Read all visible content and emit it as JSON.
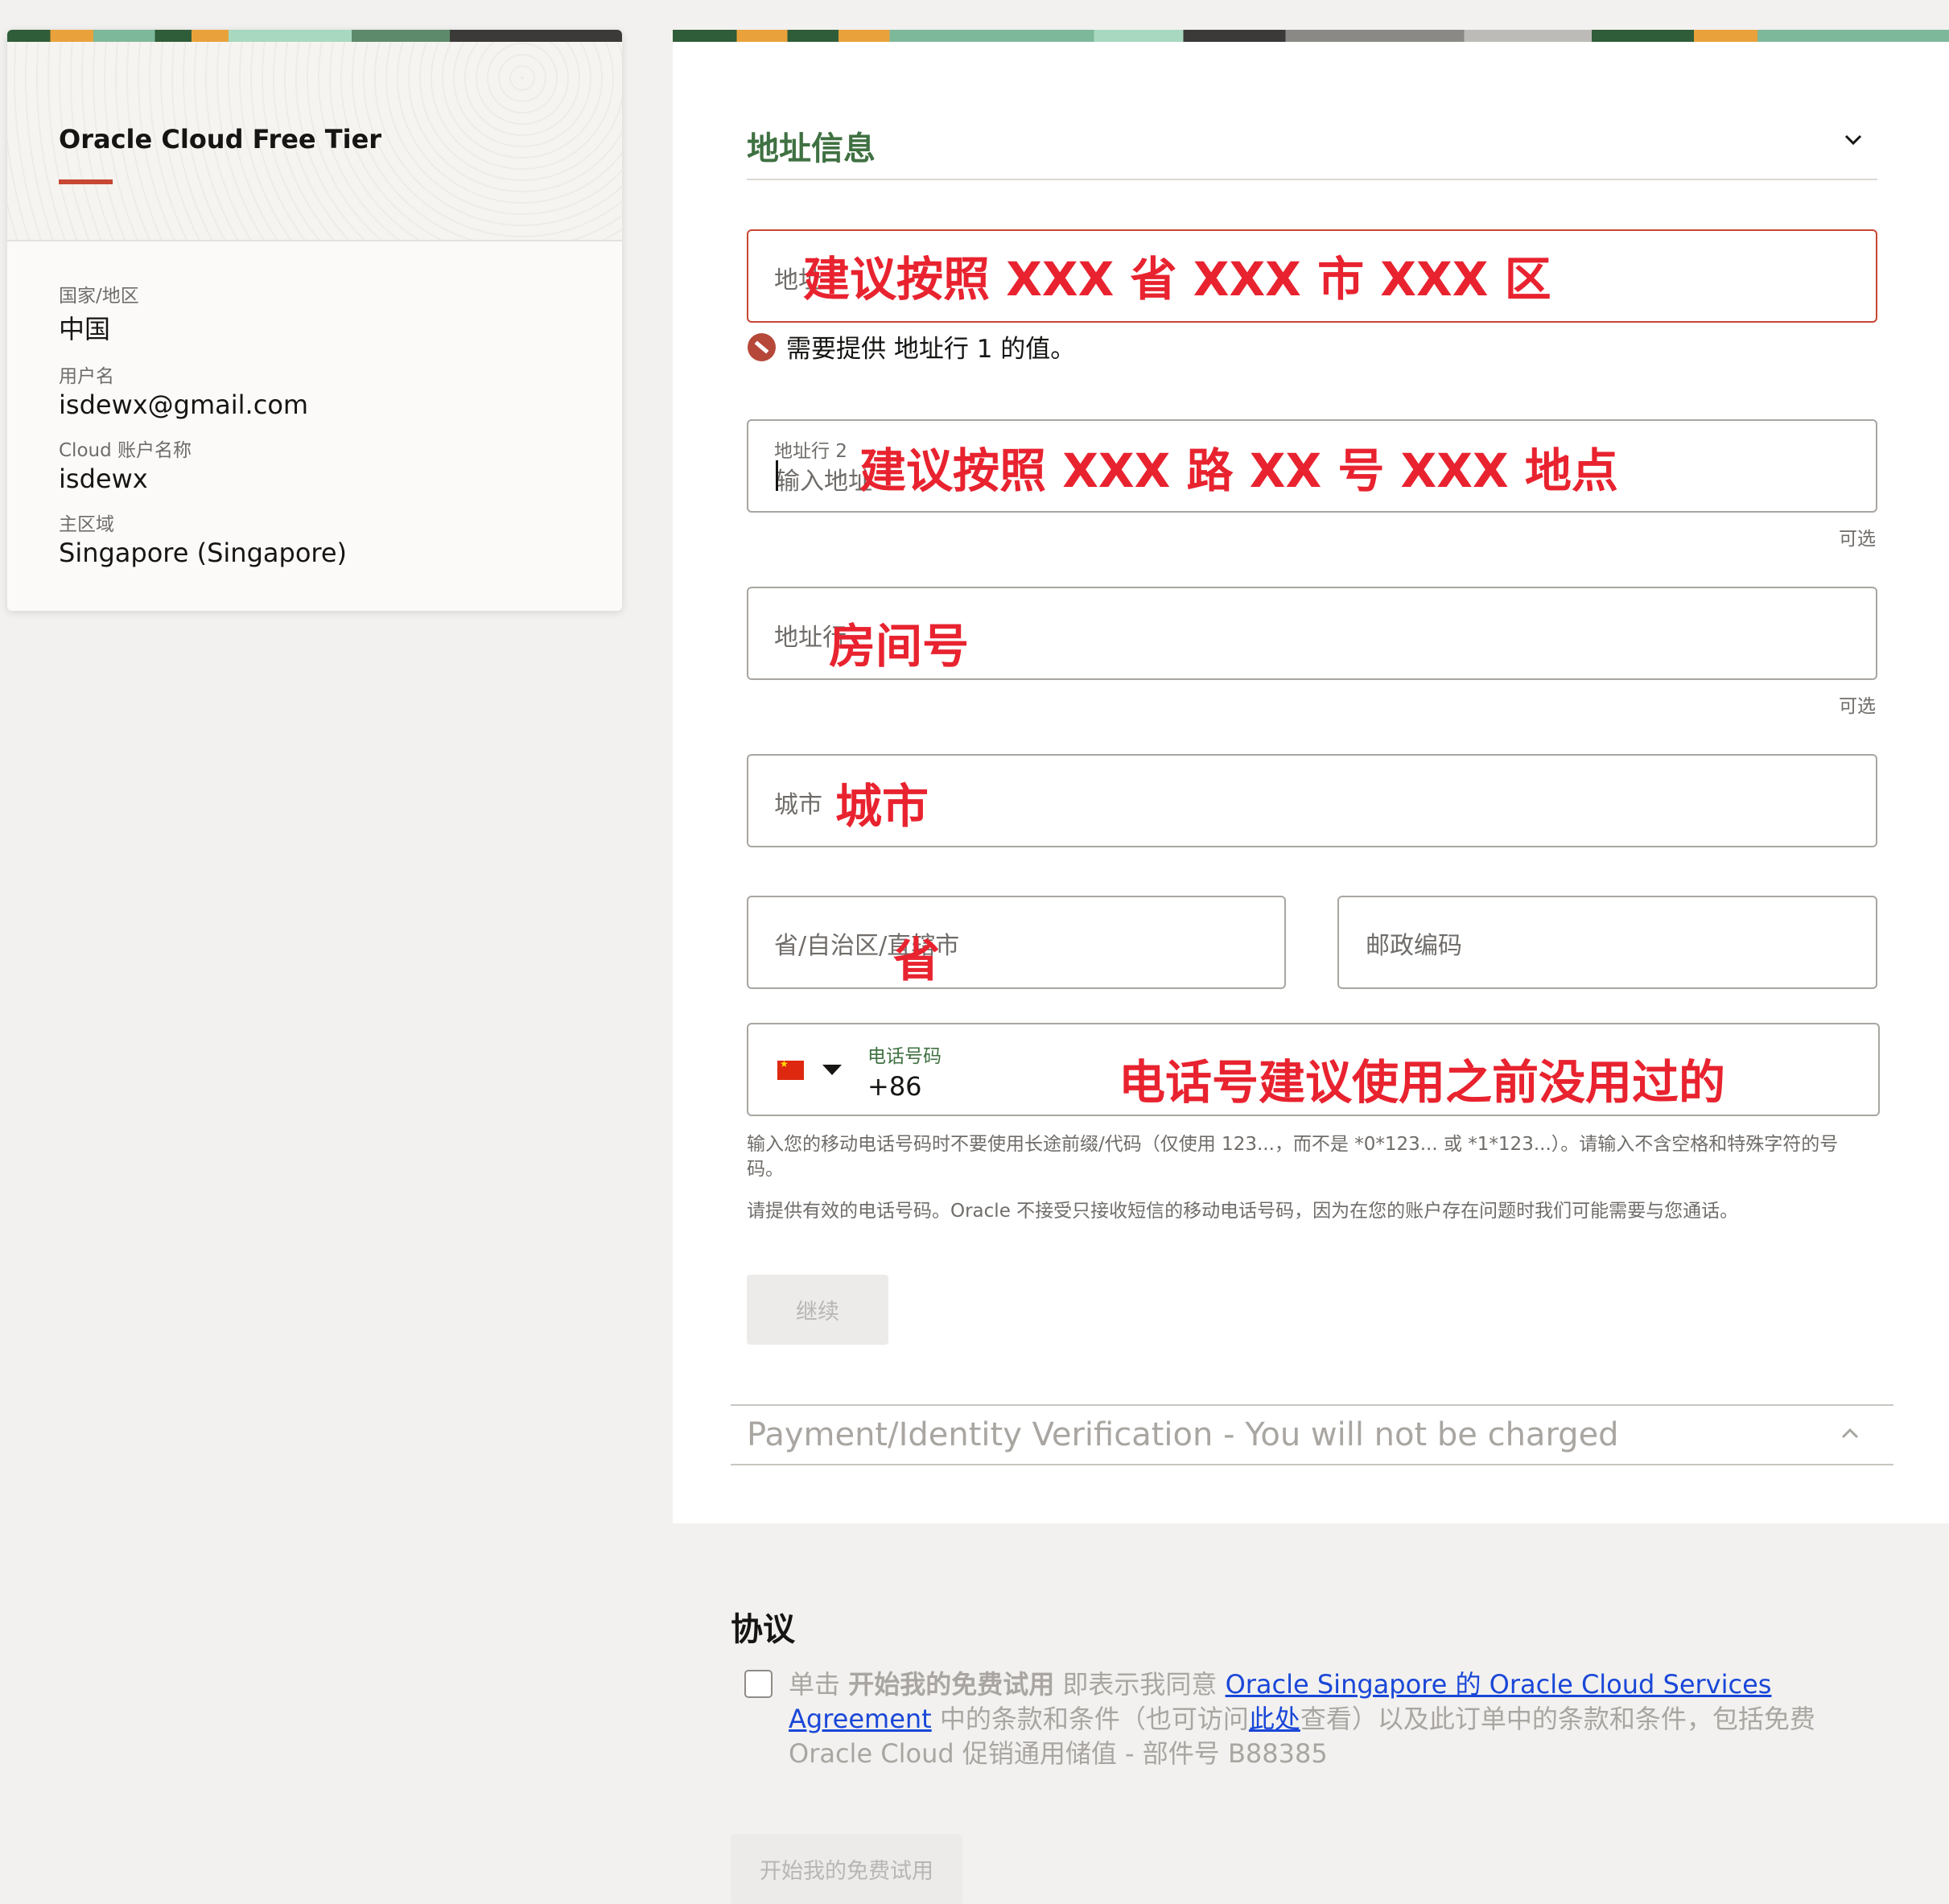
{
  "left_panel": {
    "title": "Oracle Cloud Free Tier",
    "fields": [
      {
        "label": "国家/地区",
        "value": "中国"
      },
      {
        "label": "用户名",
        "value": "isdewx@gmail.com"
      },
      {
        "label": "Cloud 账户名称",
        "value": "isdewx"
      },
      {
        "label": "主区域",
        "value": "Singapore (Singapore)"
      }
    ]
  },
  "address_section": {
    "title": "地址信息",
    "address1": {
      "label": "地址",
      "annotation": "建议按照 XXX 省 XXX 市 XXX 区",
      "error": "需要提供 地址行 1 的值。"
    },
    "address2": {
      "label": "地址行 2",
      "placeholder": "输入地址",
      "annotation": "建议按照 XXX 路   XX 号   XXX 地点",
      "optional": "可选"
    },
    "address3": {
      "label": "地址行",
      "annotation": "房间号",
      "optional": "可选"
    },
    "city": {
      "label": "城市",
      "annotation": "城市"
    },
    "province": {
      "label": "省/自治区/直辖市",
      "annotation": "省"
    },
    "postal": {
      "label": "邮政编码"
    },
    "phone": {
      "label": "电话号码",
      "value": "+86",
      "annotation": "电话号建议使用之前没用过的",
      "country_flag": "china-flag-icon"
    },
    "phone_help_1": "输入您的移动电话号码时不要使用长途前缀/代码（仅使用 123...，而不是 *0*123... 或 *1*123...）。请输入不含空格和特殊字符的号码。",
    "phone_help_2": "请提供有效的电话号码。Oracle 不接受只接收短信的移动电话号码，因为在您的账户存在问题时我们可能需要与您通话。",
    "continue_label": "继续"
  },
  "payment_section": {
    "title": "Payment/Identity Verification - You will not be charged"
  },
  "agreement": {
    "title": "协议",
    "text_1": "单击 ",
    "text_bold": "开始我的免费试用",
    "text_2": " 即表示我同意 ",
    "link_1": "Oracle Singapore 的 Oracle Cloud Services Agreement",
    "text_3": " 中的条款和条件（也可访问",
    "link_2": "此处",
    "text_4": "查看）以及此订单中的条款和条件，包括免费 Oracle Cloud 促销通用储值 - 部件号 B88385",
    "start_button": "开始我的免费试用"
  },
  "colors": {
    "accent_red": "#c74634",
    "section_green": "#3f7142",
    "annotation_red": "#e8232f",
    "link_blue": "#1a47d8"
  }
}
